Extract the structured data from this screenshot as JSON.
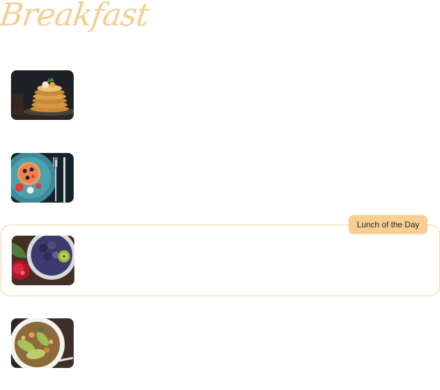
{
  "section": {
    "title": "Breakfast",
    "accent_color": "#f3cf94"
  },
  "items": [
    {
      "image": "pancake-stack-photo"
    },
    {
      "image": "fruit-toast-plate-photo"
    },
    {
      "image": "berry-kiwi-bowl-photo",
      "badge": "Lunch of the Day",
      "highlighted": true
    },
    {
      "image": "avocado-salad-bowl-photo"
    }
  ]
}
